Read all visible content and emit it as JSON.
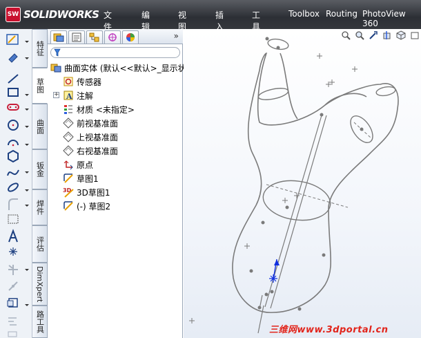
{
  "app": {
    "logo_badge": "SW",
    "logo_text": "SOLIDWORKS"
  },
  "menu": [
    {
      "label": "文件(F)"
    },
    {
      "label": "编辑(E)"
    },
    {
      "label": "视图(V)"
    },
    {
      "label": "插入(I)"
    },
    {
      "label": "工具(T)"
    },
    {
      "label": "Toolbox"
    },
    {
      "label": "Routing"
    },
    {
      "label": "PhotoView 360"
    }
  ],
  "vertical_tabs": [
    {
      "label": "特征"
    },
    {
      "label": "草图"
    },
    {
      "label": "曲面"
    },
    {
      "label": "钣金"
    },
    {
      "label": "焊件"
    },
    {
      "label": "评估"
    },
    {
      "label": "DimXpert"
    },
    {
      "label": "路工具"
    }
  ],
  "feature_manager": {
    "more_glyph": "»",
    "filter_placeholder": "",
    "tree": [
      {
        "label": "曲面实体  (默认<<默认>_显示状",
        "icon": "part-icon"
      },
      {
        "label": "传感器",
        "icon": "sensor-icon"
      },
      {
        "label": "注解",
        "icon": "annotation-icon"
      },
      {
        "label": "材质 <未指定>",
        "icon": "material-icon"
      },
      {
        "label": "前视基准面",
        "icon": "plane-icon"
      },
      {
        "label": "上视基准面",
        "icon": "plane-icon"
      },
      {
        "label": "右视基准面",
        "icon": "plane-icon"
      },
      {
        "label": "原点",
        "icon": "origin-icon"
      },
      {
        "label": "草图1",
        "icon": "sketch-icon"
      },
      {
        "label": "3D草图1",
        "icon": "3d-sketch-icon"
      },
      {
        "label": "(-) 草图2",
        "icon": "sketch-icon"
      }
    ]
  },
  "watermark": "三维网www.3dportal.cn",
  "colors": {
    "menubar": "#34373c",
    "accent": "#c8102e",
    "sketch_line": "#7a7a7a",
    "triad": "#1030e0",
    "watermark": "#e2231a"
  }
}
